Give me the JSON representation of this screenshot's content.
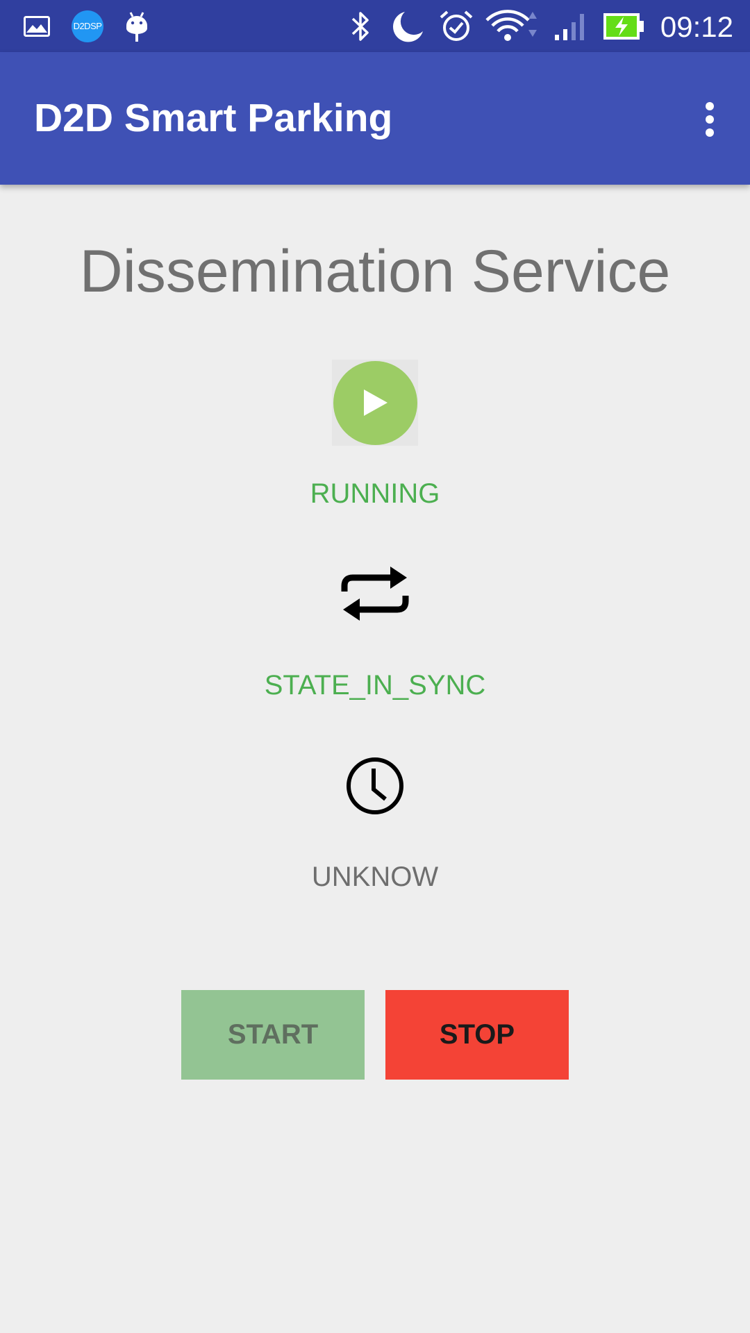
{
  "status_bar": {
    "time": "09:12",
    "notification_badge": "D2DSP",
    "icons": [
      "image-icon",
      "d2dsp-icon",
      "android-icon",
      "bluetooth-icon",
      "moon-icon",
      "alarm-icon",
      "wifi-icon",
      "signal-icon",
      "battery-charging-icon"
    ],
    "battery_color": "#64dd17"
  },
  "app_bar": {
    "title": "D2D Smart Parking",
    "menu_icon": "more-vert-icon",
    "color": "#3f51b5"
  },
  "main": {
    "title": "Dissemination Service",
    "service_state": {
      "icon": "play-icon",
      "label": "RUNNING",
      "color": "#4caf50"
    },
    "sync_state": {
      "icon": "repeat-icon",
      "label": "STATE_IN_SYNC",
      "color": "#4caf50"
    },
    "time_state": {
      "icon": "clock-icon",
      "label": "UNKNOW",
      "color": "#6e6e6e"
    }
  },
  "buttons": {
    "start_label": "START",
    "stop_label": "STOP",
    "start_color": "#93c493",
    "stop_color": "#f44336"
  }
}
